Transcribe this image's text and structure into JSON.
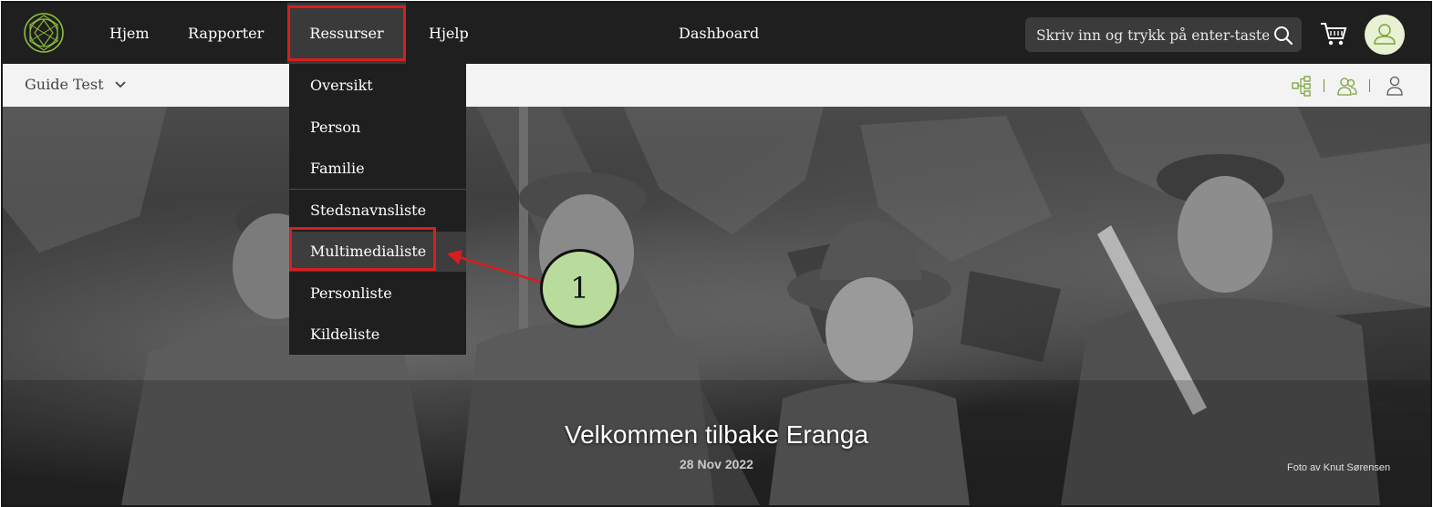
{
  "nav": {
    "items": [
      "Hjem",
      "Rapporter",
      "Ressurser",
      "Hjelp",
      "Dashboard"
    ],
    "active": "Ressurser"
  },
  "search": {
    "placeholder": "Skriv inn og trykk på enter-tasten"
  },
  "tree": {
    "name": "Guide Test"
  },
  "dropdown": {
    "items": [
      "Oversikt",
      "Person",
      "Familie",
      "Stedsnavnsliste",
      "Multimedialiste",
      "Personliste",
      "Kildeliste"
    ],
    "highlighted": "Multimedialiste"
  },
  "hero": {
    "title": "Velkommen tilbake Eranga",
    "date": "28 Nov 2022",
    "credit": "Foto av Knut Sørensen"
  },
  "annotation": {
    "step": "1"
  },
  "colors": {
    "nav_bg": "#1f1f1f",
    "accent": "#7aa33a",
    "highlight": "#d71e1e",
    "callout": "#b9dc9d"
  },
  "icons": [
    "logo-icon",
    "search-icon",
    "cart-icon",
    "user-icon",
    "tree-view-icon",
    "group-icon",
    "person-icon",
    "chevron-down-icon"
  ]
}
